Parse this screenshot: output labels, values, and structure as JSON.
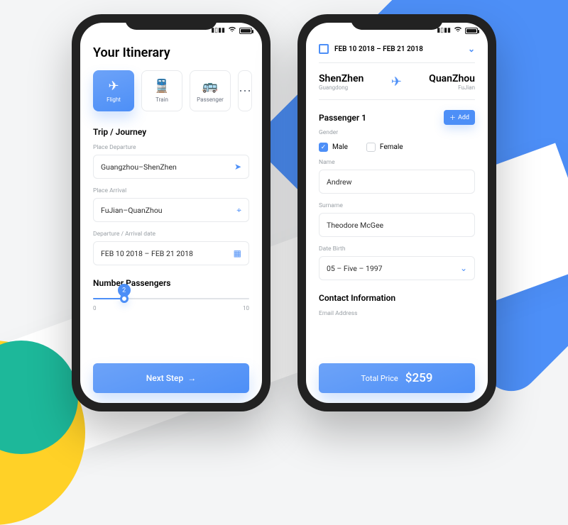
{
  "colors": {
    "accent": "#4d8ff7",
    "yellow": "#ffd127",
    "teal": "#1db89a"
  },
  "statusbar": {
    "signal": "▮▮▮",
    "wifi": "⌁",
    "battery_full": true
  },
  "screenA": {
    "title": "Your Itinerary",
    "tabs": [
      {
        "label": "Flight",
        "icon": "plane",
        "active": true
      },
      {
        "label": "Train",
        "icon": "train",
        "active": false
      },
      {
        "label": "Passenger",
        "icon": "bus",
        "active": false
      },
      {
        "label": "",
        "icon": "generic",
        "active": false
      }
    ],
    "section1": "Trip / Journey",
    "departure_label": "Place Departure",
    "departure_value": "Guangzhou–ShenZhen",
    "arrival_label": "Place Arrival",
    "arrival_value": "FuJian–QuanZhou",
    "date_label": "Departure / Arrival date",
    "date_value": "FEB 10 2018 – FEB 21 2018",
    "section2": "Number Passengers",
    "slider": {
      "min": 0,
      "max": 10,
      "value": 2
    },
    "cta": "Next Step"
  },
  "screenB": {
    "date_range": "FEB 10 2018 – FEB 21 2018",
    "from": {
      "city": "ShenZhen",
      "province": "Guangdong"
    },
    "to": {
      "city": "QuanZhou",
      "province": "FuJian"
    },
    "passenger_heading": "Passenger 1",
    "add_label": "Add",
    "gender_label": "Gender",
    "gender_options": {
      "male": "Male",
      "female": "Female",
      "selected": "male"
    },
    "name_label": "Name",
    "name_value": "Andrew",
    "surname_label": "Surname",
    "surname_value": "Theodore McGee",
    "dob_label": "Date Birth",
    "dob_value": "05 – Five – 1997",
    "contact_heading": "Contact Information",
    "email_label": "Email Address",
    "price_label": "Total Price",
    "price_value": "$259"
  }
}
